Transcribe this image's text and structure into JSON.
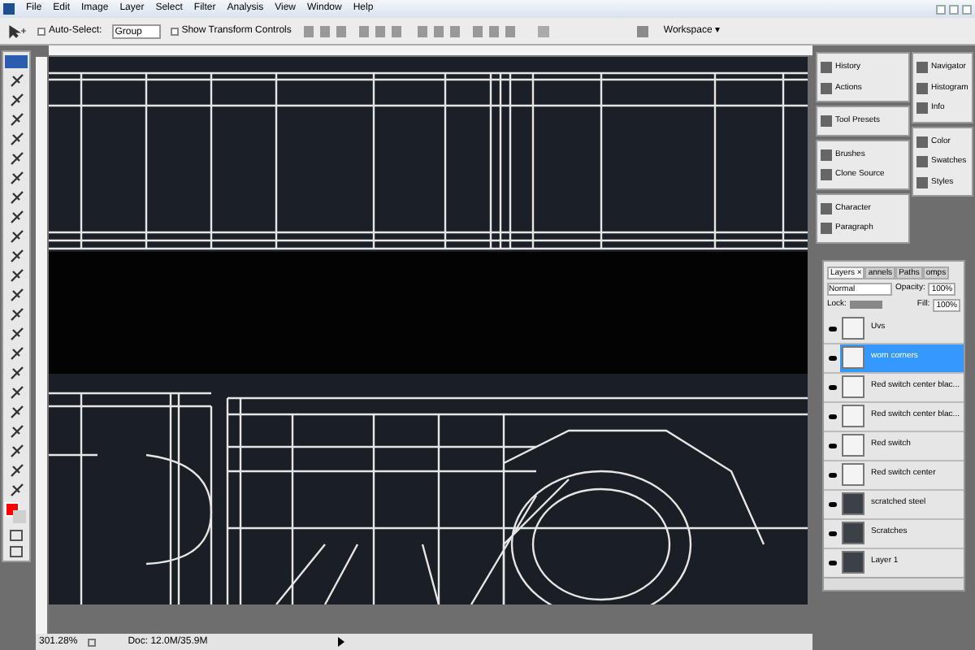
{
  "menu_bar": {
    "items": [
      "File",
      "Edit",
      "Image",
      "Layer",
      "Select",
      "Filter",
      "Analysis",
      "View",
      "Window",
      "Help"
    ]
  },
  "options_bar": {
    "auto_select": {
      "label": "Auto-Select:",
      "checked": false
    },
    "auto_select_target": "Group",
    "show_transform_controls": {
      "label": "Show Transform Controls",
      "checked": false
    },
    "workspace": "Workspace ▾"
  },
  "panel_dock": {
    "column_1": [
      [
        "History",
        "Actions"
      ],
      [
        "Tool Presets"
      ],
      [
        "Brushes",
        "Clone Source"
      ],
      [
        "Character",
        "Paragraph"
      ]
    ],
    "column_2": [
      [
        "Navigator",
        "Histogram",
        "Info"
      ],
      [
        "Color",
        "Swatches",
        "Styles"
      ]
    ]
  },
  "layers_panel": {
    "tabs": [
      {
        "label": "Layers ×",
        "selected": true
      },
      {
        "label": "annels",
        "selected": false
      },
      {
        "label": "Paths",
        "selected": false
      },
      {
        "label": "omps",
        "selected": false
      }
    ],
    "blend_mode": "Normal",
    "opacity_label": "Opacity:",
    "opacity": "100%",
    "lock_label": "Lock:",
    "fill_label": "Fill:",
    "fill": "100%",
    "layers": [
      {
        "name": "Uvs",
        "visible": true,
        "selected": false,
        "kind": "transparent"
      },
      {
        "name": "worn corners",
        "visible": true,
        "selected": true,
        "kind": "transparent"
      },
      {
        "name": "Red switch center blac...",
        "visible": true,
        "selected": false,
        "kind": "transparent"
      },
      {
        "name": "Red switch center blac...",
        "visible": true,
        "selected": false,
        "kind": "transparent"
      },
      {
        "name": "Red switch",
        "visible": true,
        "selected": false,
        "kind": "transparent"
      },
      {
        "name": "Red switch center",
        "visible": true,
        "selected": false,
        "kind": "transparent"
      },
      {
        "name": "scratched steel",
        "visible": true,
        "selected": false,
        "kind": "texture"
      },
      {
        "name": "Scratches",
        "visible": true,
        "selected": false,
        "kind": "texture"
      },
      {
        "name": "Layer 1",
        "visible": true,
        "selected": false,
        "kind": "texture"
      }
    ]
  },
  "status_bar": {
    "zoom": "301.28%",
    "doc": "Doc: 12.0M/35.9M"
  }
}
